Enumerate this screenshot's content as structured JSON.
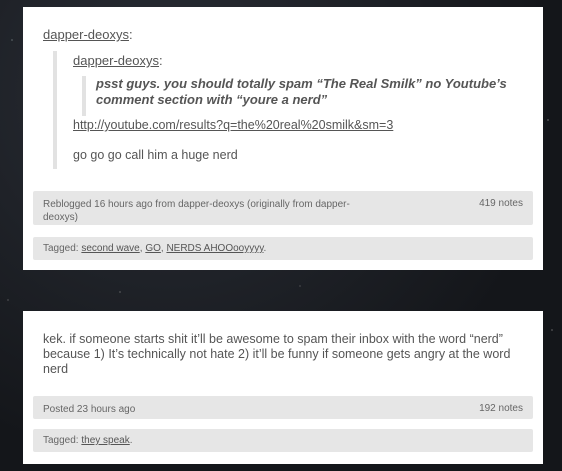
{
  "post1": {
    "author": "dapper-deoxys",
    "colon": ":",
    "quoted_author": "dapper-deoxys",
    "quoted_text": "psst guys. you should totally spam “The Real Smilk” no Youtube’s comment section with “youre a nerd”",
    "link": "http://youtube.com/results?q=the%20real%20smilk&sm=3",
    "comment": "go go go call him a huge nerd",
    "meta": "Reblogged 16 hours ago from dapper-deoxys (originally from dapper-deoxys)",
    "notes": "419 notes",
    "tagged_label": "Tagged:",
    "tags": [
      "second wave",
      "GO",
      "NERDS AHOOooyyyy"
    ],
    "sep": ", ",
    "end": "."
  },
  "post2": {
    "body": "kek. if someone starts shit it’ll be awesome to spam their inbox with the word “nerd” because 1) It’s technically not hate 2) it’ll be funny if someone gets angry at the word nerd",
    "meta": "Posted 23 hours ago",
    "notes": "192 notes",
    "tagged_label": "Tagged:",
    "tags": [
      "they speak"
    ],
    "end": "."
  }
}
